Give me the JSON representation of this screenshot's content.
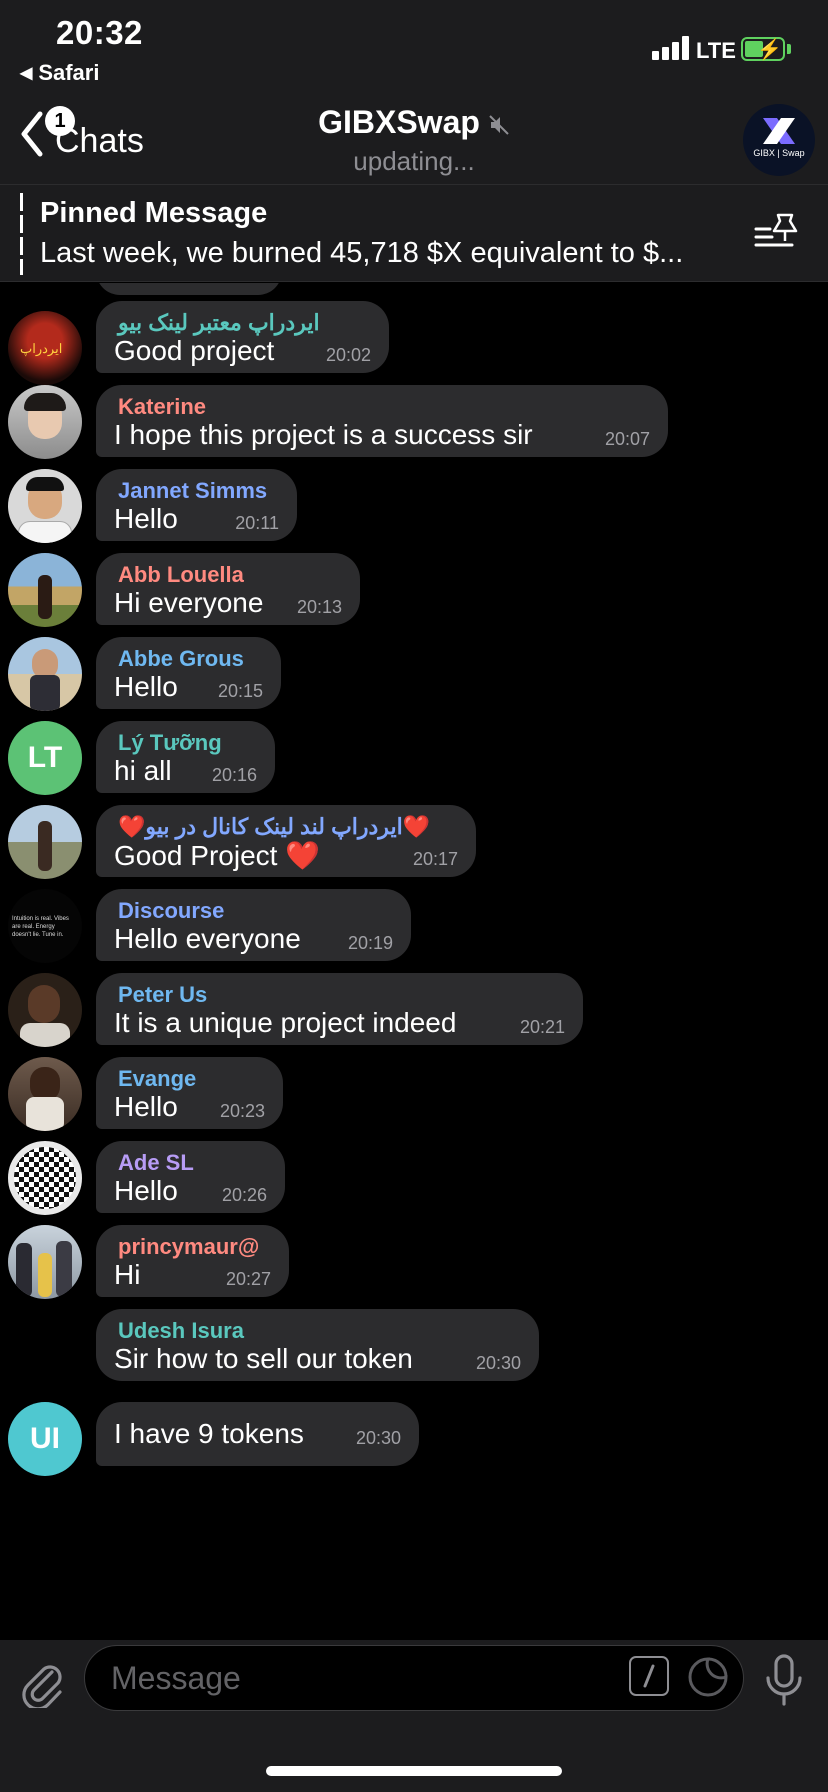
{
  "status_bar": {
    "time": "20:32",
    "back_app": "Safari",
    "network": "LTE"
  },
  "header": {
    "back_label": "Chats",
    "unread_badge": "1",
    "title": "GIBXSwap",
    "subtitle": "updating...",
    "avatar_text": "GIBX | Swap"
  },
  "pinned": {
    "title": "Pinned Message",
    "text": "Last week, we burned 45,718 $X equivalent to $..."
  },
  "messages": [
    {
      "sender": "ایردراپ معتبر لینک بیو",
      "text": "Good project",
      "time": "20:02",
      "sender_color": "#5ac8be",
      "avatar": "photo-airdrop"
    },
    {
      "sender": "Katerine",
      "text": "I hope this project is a success sir",
      "time": "20:07",
      "sender_color": "#ff8a80",
      "avatar": "photo-katerine"
    },
    {
      "sender": "Jannet Simms",
      "text": "Hello",
      "time": "20:11",
      "sender_color": "#82a8ff",
      "avatar": "photo-jannet"
    },
    {
      "sender": "Abb Louella",
      "text": "Hi everyone",
      "time": "20:13",
      "sender_color": "#ff8a80",
      "avatar": "photo-abb"
    },
    {
      "sender": "Abbe Grous",
      "text": "Hello",
      "time": "20:15",
      "sender_color": "#6fb8f0",
      "avatar": "photo-abbe"
    },
    {
      "sender": "Lý Tưỡng",
      "text": "hi all",
      "time": "20:16",
      "sender_color": "#5ac8be",
      "avatar_initials": "LT",
      "avatar_color": "#5cc275"
    },
    {
      "sender": "❤️ایردراپ لند لینک کانال در بیو❤️",
      "text": "Good Project ❤️",
      "time": "20:17",
      "sender_color": "#82a8ff",
      "avatar": "photo-landscape"
    },
    {
      "sender": "Discourse",
      "text": "Hello everyone",
      "time": "20:19",
      "sender_color": "#82a8ff",
      "avatar": "photo-text",
      "avatar_caption": "Intuition is real. Vibes are real. Energy doesn't lie. Tune in."
    },
    {
      "sender": "Peter Us",
      "text": "It is a unique project indeed",
      "time": "20:21",
      "sender_color": "#6fb8f0",
      "avatar": "photo-peter"
    },
    {
      "sender": "Evange",
      "text": "Hello",
      "time": "20:23",
      "sender_color": "#6fb8f0",
      "avatar": "photo-evange"
    },
    {
      "sender": "Ade SL",
      "text": "Hello",
      "time": "20:26",
      "sender_color": "#b79cf5",
      "avatar": "photo-qr"
    },
    {
      "sender": "princymaur@",
      "text": "Hi",
      "time": "20:27",
      "sender_color": "#ff8a80",
      "avatar": "photo-family"
    },
    {
      "sender": "Udesh Isura",
      "text": "Sir how to sell our token",
      "time": "20:30",
      "sender_color": "#5ac8be"
    },
    {
      "text": "I have 9 tokens",
      "time": "20:30",
      "avatar_initials": "UI",
      "avatar_color": "#4fc8d0"
    }
  ],
  "input": {
    "placeholder": "Message"
  }
}
